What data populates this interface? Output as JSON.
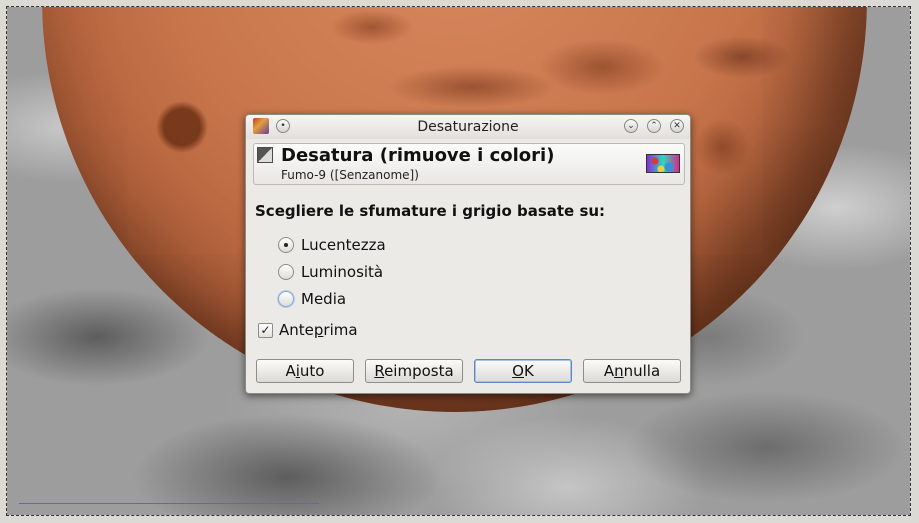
{
  "dialog": {
    "title": "Desaturazione",
    "header": {
      "title": "Desatura (rimuove i colori)",
      "subtitle": "Fumo-9 ([Senzanome])"
    },
    "section_label": "Scegliere le sfumature i grigio basate su:",
    "options": [
      {
        "label": "Lucentezza",
        "selected": true
      },
      {
        "label": "Luminosità",
        "selected": false
      },
      {
        "label": "Media",
        "selected": false
      }
    ],
    "preview": {
      "label_pre": "Ante",
      "label_mnemonic": "p",
      "label_post": "rima",
      "checked": true
    },
    "buttons": {
      "help": {
        "pre": "A",
        "mnemonic": "i",
        "post": "uto"
      },
      "reset": {
        "pre": "",
        "mnemonic": "R",
        "post": "eimposta"
      },
      "ok": {
        "pre": "",
        "mnemonic": "O",
        "post": "K"
      },
      "cancel": {
        "pre": "A",
        "mnemonic": "n",
        "post": "nulla"
      }
    },
    "titlebar_buttons": {
      "menu": "•",
      "minimize": "⌄",
      "maximize": "⌃",
      "close": "✕"
    },
    "check_glyph": "✓"
  }
}
